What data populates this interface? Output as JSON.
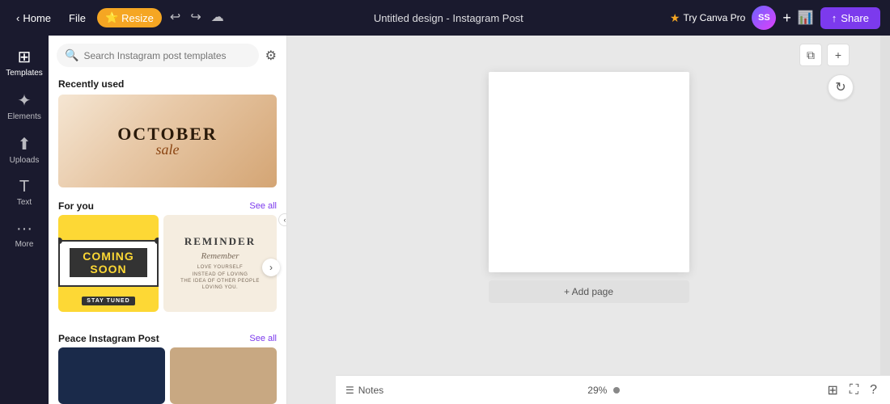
{
  "topbar": {
    "home_label": "Home",
    "file_label": "File",
    "resize_label": "Resize",
    "title": "Untitled design - Instagram Post",
    "try_canva_label": "Try Canva Pro",
    "avatar_initials": "SS",
    "share_label": "Share"
  },
  "sidebar": {
    "items": [
      {
        "id": "templates",
        "label": "Templates",
        "icon": "⊞"
      },
      {
        "id": "elements",
        "label": "Elements",
        "icon": "✦"
      },
      {
        "id": "uploads",
        "label": "Uploads",
        "icon": "↑"
      },
      {
        "id": "text",
        "label": "Text",
        "icon": "T"
      },
      {
        "id": "more",
        "label": "More",
        "icon": "···"
      }
    ]
  },
  "templates_panel": {
    "search_placeholder": "Search Instagram post templates",
    "recently_used_title": "Recently used",
    "for_you_title": "For you",
    "see_all_label": "See all",
    "peace_section_title": "Peace Instagram Post",
    "october_sale": {
      "line1": "OCTOBER",
      "line2": "sale"
    },
    "coming_soon": {
      "title": "COMING SOON",
      "subtitle": "STAY TUNED"
    },
    "reminder": {
      "title": "REMINDER",
      "cursive": "Remember",
      "line1": "LOVE YOURSELF",
      "line2": "INSTEAD OF LOVING",
      "line3": "THE IDEA OF OTHER PEOPLE",
      "line4": "LOVING YOU."
    }
  },
  "canvas": {
    "add_page_label": "+ Add page"
  },
  "bottombar": {
    "notes_label": "Notes",
    "zoom_level": "29%"
  },
  "colors": {
    "topbar_bg": "#1e1e2d",
    "accent_purple": "#7c3aed",
    "canva_yellow": "#f5a623"
  }
}
